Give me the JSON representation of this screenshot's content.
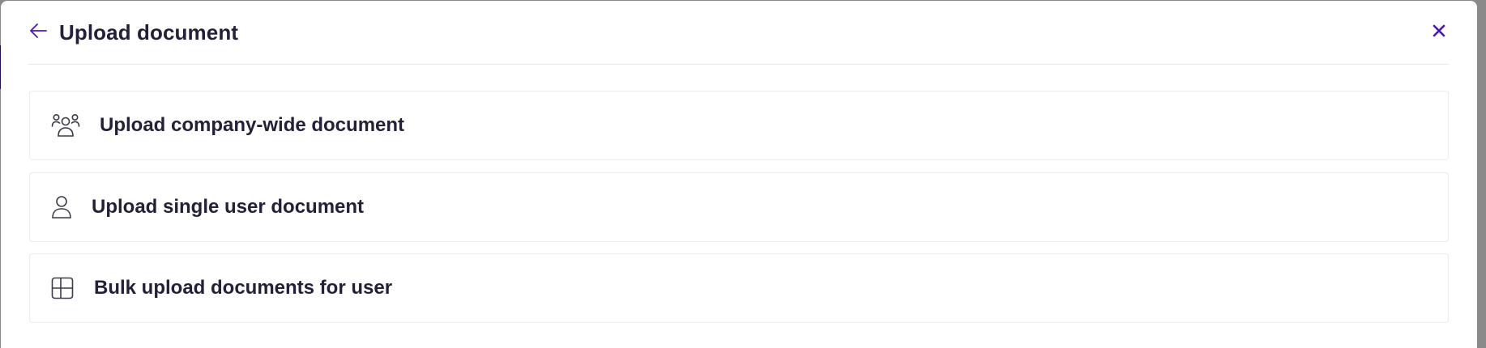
{
  "modal": {
    "title": "Upload document",
    "back_icon": "arrow-left-icon",
    "close_icon": "close-icon"
  },
  "options": [
    {
      "label": "Upload company-wide document",
      "icon": "users-group-icon"
    },
    {
      "label": "Upload single user document",
      "icon": "user-icon"
    },
    {
      "label": "Bulk upload documents for user",
      "icon": "table-grid-icon"
    }
  ],
  "colors": {
    "accent": "#4a18b8",
    "text": "#23213a",
    "icon": "#3a3a4a",
    "border": "#ececf0"
  }
}
